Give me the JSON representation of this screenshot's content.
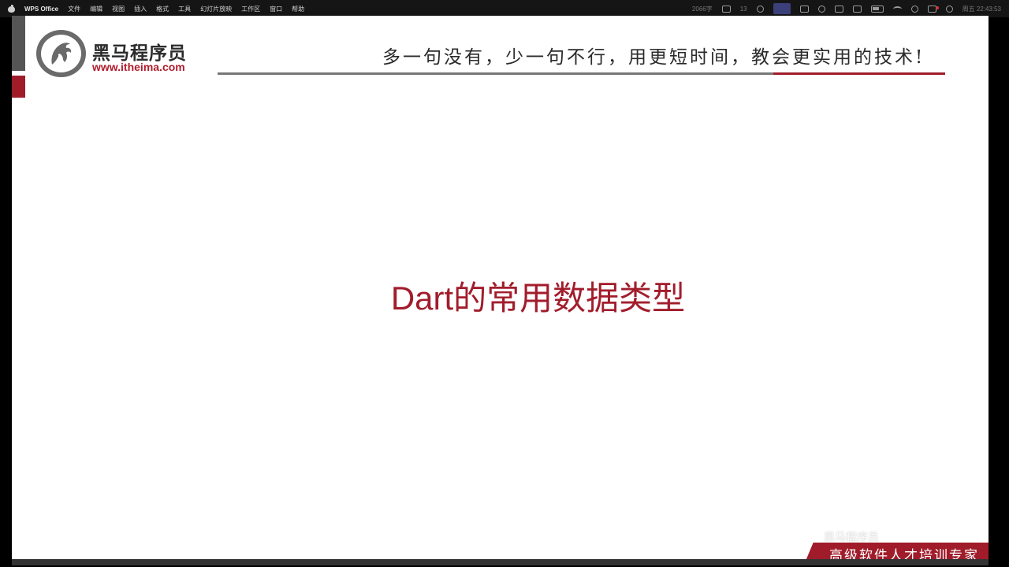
{
  "menubar": {
    "app_name": "WPS Office",
    "menus": [
      "文件",
      "编辑",
      "视图",
      "插入",
      "格式",
      "工具",
      "幻灯片放映",
      "工作区",
      "窗口",
      "帮助"
    ],
    "status": {
      "left_label": "2066字",
      "count": "13",
      "clock": "周五 22:43:53"
    }
  },
  "slide": {
    "brand_name": "黑马程序员",
    "brand_url": "www.itheima.com",
    "slogan": "多一句没有，少一句不行，用更短时间，教会更实用的技术!",
    "title": "Dart的常用数据类型",
    "footer_badge": "高级软件人才培训专家",
    "watermark": "黑马程序员"
  },
  "colors": {
    "brand_red": "#a01c2a",
    "title_red": "#a21d2c",
    "menubar_bg": "#151515"
  }
}
